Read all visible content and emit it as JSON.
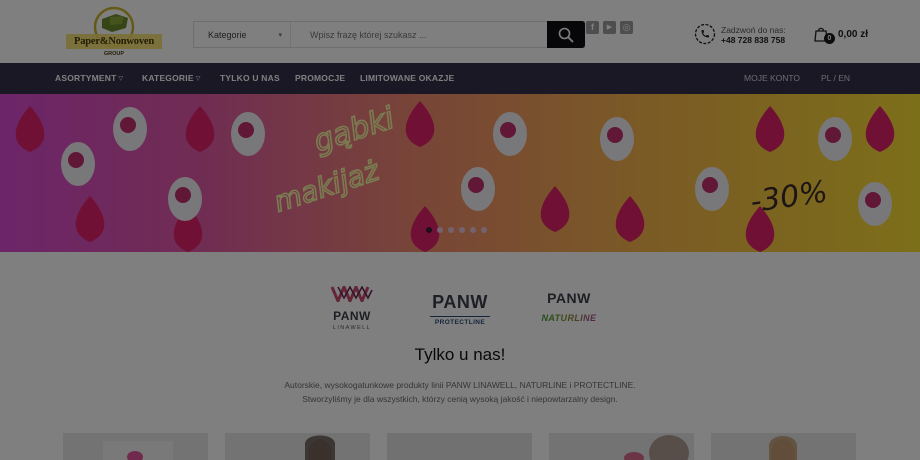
{
  "header": {
    "logo": {
      "text": "Paper&Nonwoven",
      "subtext": "GROUP"
    },
    "search": {
      "category_label": "Kategorie",
      "placeholder": "Wpisz frazę której szukasz ..."
    },
    "social": [
      {
        "icon": "facebook-icon",
        "glyph": "f"
      },
      {
        "icon": "youtube-icon",
        "glyph": "▶"
      },
      {
        "icon": "instagram-icon",
        "glyph": "◎"
      }
    ],
    "contact": {
      "label": "Zadzwoń do nas:",
      "phone": "+48 728 838 758"
    },
    "cart": {
      "count": "0",
      "total": "0,00 zł"
    }
  },
  "nav": {
    "items": [
      {
        "label": "ASORTYMENT",
        "dropdown": true
      },
      {
        "label": "KATEGORIE",
        "dropdown": true
      },
      {
        "label": "TYLKO U NAS",
        "dropdown": false
      },
      {
        "label": "PROMOCJE",
        "dropdown": false
      },
      {
        "label": "LIMITOWANE OKAZJE",
        "dropdown": false
      }
    ],
    "account": "MOJE KONTO",
    "lang": {
      "pl": "PL",
      "separator": " / ",
      "en": "EN"
    }
  },
  "banner": {
    "headline_line1": "gąbki",
    "headline_line2": "makijaż",
    "discount": "-30%",
    "slides_total": 6,
    "active_slide": 1
  },
  "brands": [
    {
      "name": "PANW",
      "sub": "LINAWELL"
    },
    {
      "name": "PANW",
      "sub": "PROTECTLINE"
    },
    {
      "name": "PANW",
      "sub": "NATURLINE"
    }
  ],
  "section": {
    "title": "Tylko u nas!",
    "desc_line1": "Autorskie, wysokogatunkowe produkty linii PANW LINAWELL, NATURLINE i PROTECTLINE.",
    "desc_line2": "Stworzyliśmy je dla wszystkich, którzy cenią wysoką jakość i niepowtarzalny design."
  },
  "colors": {
    "nav_bg": "#34314a",
    "search_button": "#0e0e14",
    "scrim": "rgba(0,0,0,0.5)"
  }
}
